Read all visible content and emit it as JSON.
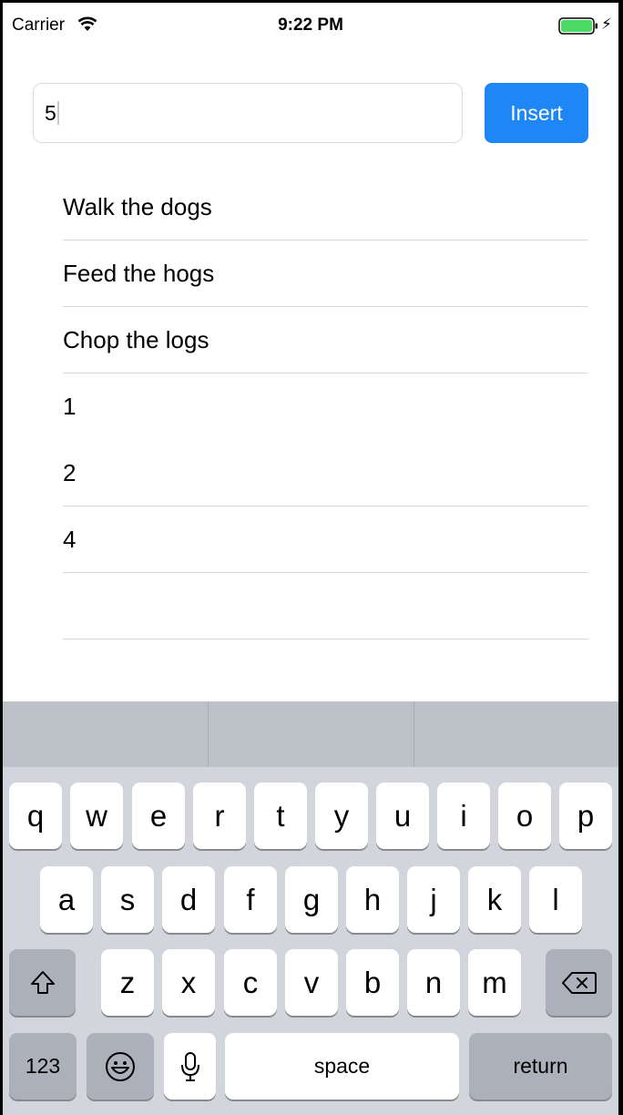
{
  "status_bar": {
    "carrier": "Carrier",
    "time": "9:22 PM",
    "battery_color": "#4cd964"
  },
  "input": {
    "value": "5"
  },
  "insert_button": {
    "label": "Insert",
    "color": "#1e86f5"
  },
  "list": {
    "items": [
      "Walk the dogs",
      "Feed the hogs",
      "Chop the logs",
      "1",
      "2",
      "4",
      ""
    ]
  },
  "keyboard": {
    "row1": [
      "q",
      "w",
      "e",
      "r",
      "t",
      "y",
      "u",
      "i",
      "o",
      "p"
    ],
    "row2": [
      "a",
      "s",
      "d",
      "f",
      "g",
      "h",
      "j",
      "k",
      "l"
    ],
    "row3": [
      "z",
      "x",
      "c",
      "v",
      "b",
      "n",
      "m"
    ],
    "numbers_label": "123",
    "space_label": "space",
    "return_label": "return",
    "icons": [
      "shift-icon",
      "delete-icon",
      "emoji-icon",
      "microphone-icon"
    ]
  }
}
